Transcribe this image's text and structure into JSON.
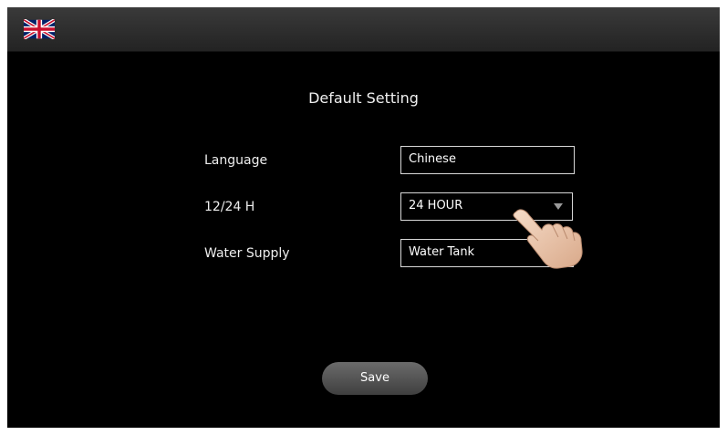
{
  "header": {
    "language_flag_icon": "uk-flag-icon"
  },
  "page": {
    "title": "Default Setting"
  },
  "settings": {
    "language": {
      "label": "Language",
      "value": "Chinese"
    },
    "time_format": {
      "label": "12/24 H",
      "value": "24 HOUR"
    },
    "water_supply": {
      "label": "Water Supply",
      "value": "Water Tank"
    }
  },
  "actions": {
    "save_label": "Save"
  }
}
